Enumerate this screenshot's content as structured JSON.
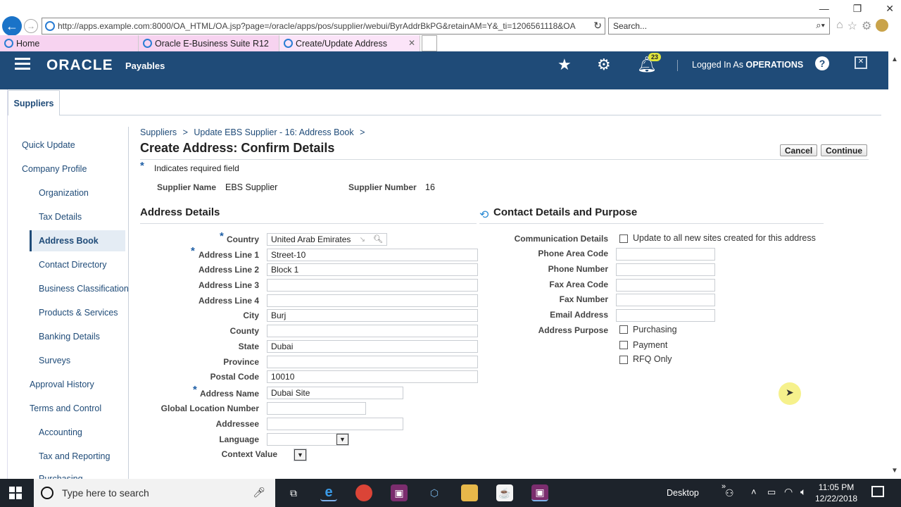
{
  "browser": {
    "url": "http://apps.example.com:8000/OA_HTML/OA.jsp?page=/oracle/apps/pos/supplier/webui/ByrAddrBkPG&retainAM=Y&_ti=1206561118&OA",
    "search_placeholder": "Search...",
    "tabs": [
      {
        "label": "Home"
      },
      {
        "label": "Oracle E-Business Suite R12"
      },
      {
        "label": "Create/Update Address"
      }
    ]
  },
  "header": {
    "brand": "ORACLE",
    "product": "Payables",
    "notification_count": "23",
    "logged_in_prefix": "Logged In As",
    "logged_in_user": "OPERATIONS"
  },
  "suppliers_tab": "Suppliers",
  "sidebar": {
    "items": [
      {
        "label": "Quick Update"
      },
      {
        "label": "Company Profile"
      },
      {
        "label": "Organization"
      },
      {
        "label": "Tax Details"
      },
      {
        "label": "Address Book"
      },
      {
        "label": "Contact Directory"
      },
      {
        "label": "Business Classification"
      },
      {
        "label": "Products & Services"
      },
      {
        "label": "Banking Details"
      },
      {
        "label": "Surveys"
      },
      {
        "label": "Approval History"
      },
      {
        "label": "Terms and Control"
      },
      {
        "label": "Accounting"
      },
      {
        "label": "Tax and Reporting"
      },
      {
        "label": "Purchasing"
      }
    ]
  },
  "breadcrumb": {
    "items": [
      "Suppliers",
      ">",
      "Update EBS Supplier - 16: Address Book",
      ">"
    ]
  },
  "page": {
    "title": "Create Address: Confirm Details",
    "cancel_label": "Cancel",
    "continue_label": "Continue",
    "required_note": "Indicates required field",
    "supplier_name_label": "Supplier Name",
    "supplier_name": "EBS Supplier",
    "supplier_number_label": "Supplier Number",
    "supplier_number": "16"
  },
  "address": {
    "heading": "Address Details",
    "fields": {
      "country": {
        "label": "Country",
        "value": "United Arab Emirates"
      },
      "line1": {
        "label": "Address Line 1",
        "value": "Street-10"
      },
      "line2": {
        "label": "Address Line 2",
        "value": "Block 1"
      },
      "line3": {
        "label": "Address Line 3",
        "value": ""
      },
      "line4": {
        "label": "Address Line 4",
        "value": ""
      },
      "city": {
        "label": "City",
        "value": "Burj"
      },
      "county": {
        "label": "County",
        "value": ""
      },
      "state": {
        "label": "State",
        "value": "Dubai"
      },
      "province": {
        "label": "Province",
        "value": ""
      },
      "postal": {
        "label": "Postal Code",
        "value": "10010"
      },
      "address_name": {
        "label": "Address Name",
        "value": "Dubai Site"
      },
      "gln": {
        "label": "Global Location Number",
        "value": ""
      },
      "addressee": {
        "label": "Addressee",
        "value": ""
      },
      "language": {
        "label": "Language",
        "value": ""
      },
      "context": {
        "label": "Context Value",
        "value": ""
      }
    }
  },
  "contact": {
    "heading": "Contact Details and Purpose",
    "communication_label": "Communication Details",
    "communication_option": "Update to all new sites created for this address",
    "phone_area_label": "Phone Area Code",
    "phone_number_label": "Phone Number",
    "fax_area_label": "Fax Area Code",
    "fax_number_label": "Fax Number",
    "email_label": "Email Address",
    "purpose_label": "Address Purpose",
    "purposes": [
      "Purchasing",
      "Payment",
      "RFQ Only"
    ]
  },
  "taskbar": {
    "search_placeholder": "Type here to search",
    "desktop_label": "Desktop",
    "time": "11:05 PM",
    "date": "12/22/2018"
  }
}
